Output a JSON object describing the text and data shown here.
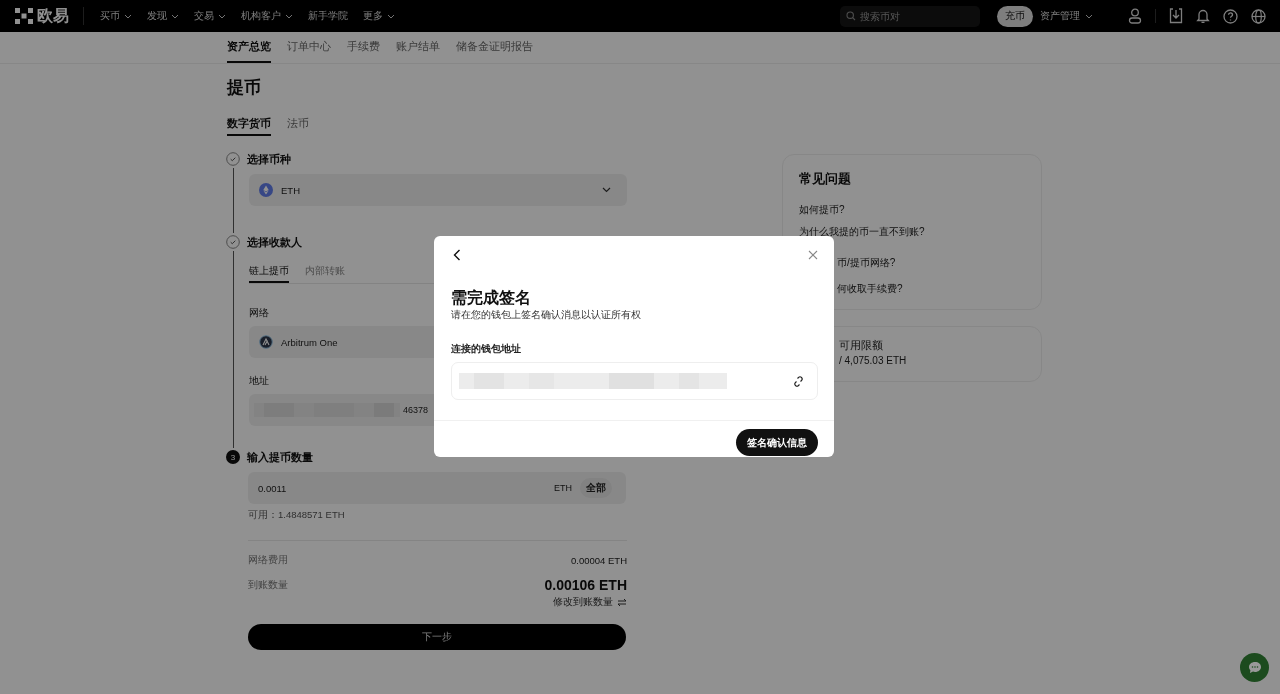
{
  "header": {
    "logo": "欧易",
    "nav": [
      {
        "label": "买币",
        "dropdown": true
      },
      {
        "label": "发现",
        "dropdown": true
      },
      {
        "label": "交易",
        "dropdown": true
      },
      {
        "label": "机构客户",
        "dropdown": true
      },
      {
        "label": "新手学院",
        "dropdown": false
      },
      {
        "label": "更多",
        "dropdown": true
      }
    ],
    "search": {
      "placeholder": "搜索币对"
    },
    "deposit_button": "充币",
    "assets_menu": "资产管理"
  },
  "subnav": [
    {
      "label": "资产总览",
      "selected": true
    },
    {
      "label": "订单中心",
      "selected": false
    },
    {
      "label": "手续费",
      "selected": false
    },
    {
      "label": "账户结单",
      "selected": false
    },
    {
      "label": "储备金证明报告",
      "selected": false
    }
  ],
  "page_title": "提币",
  "type_tabs": [
    {
      "label": "数字货币",
      "selected": true
    },
    {
      "label": "法币",
      "selected": false
    }
  ],
  "steps": [
    {
      "title": "选择币种",
      "completed": true
    },
    {
      "title": "选择收款人",
      "completed": true
    },
    {
      "title": "输入提币数量",
      "completed": false,
      "number": "3"
    }
  ],
  "coin": {
    "symbol": "ETH"
  },
  "recipient_tabs": [
    {
      "label": "链上提币",
      "selected": true
    },
    {
      "label": "内部转账",
      "selected": false
    }
  ],
  "network": {
    "label": "网络",
    "value": "Arbitrum One"
  },
  "address": {
    "label": "地址",
    "value": "46378"
  },
  "amount": {
    "value": "0.0011",
    "unit": "ETH",
    "max_button": "全部",
    "available": "可用：1.4848571 ETH"
  },
  "fees": [
    {
      "label": "网络费用",
      "value": "0.00004 ETH",
      "emphasis": false
    },
    {
      "label": "到账数量",
      "value": "0.00106 ETH",
      "emphasis": true
    }
  ],
  "edit_link": "修改到账数量",
  "next_button": "下一步",
  "faq": {
    "title": "常见问题",
    "items": [
      "如何提币?",
      "为什么我提的币一直不到账?",
      "币/提币网络?",
      "何收取手续费?"
    ]
  },
  "limit": {
    "title": "可用限额",
    "value": "/ 4,075.03 ETH"
  },
  "modal": {
    "title": "需完成签名",
    "subtitle": "请在您的钱包上签名确认消息以认证所有权",
    "field_label": "连接的钱包地址",
    "confirm_button": "签名确认信息"
  }
}
